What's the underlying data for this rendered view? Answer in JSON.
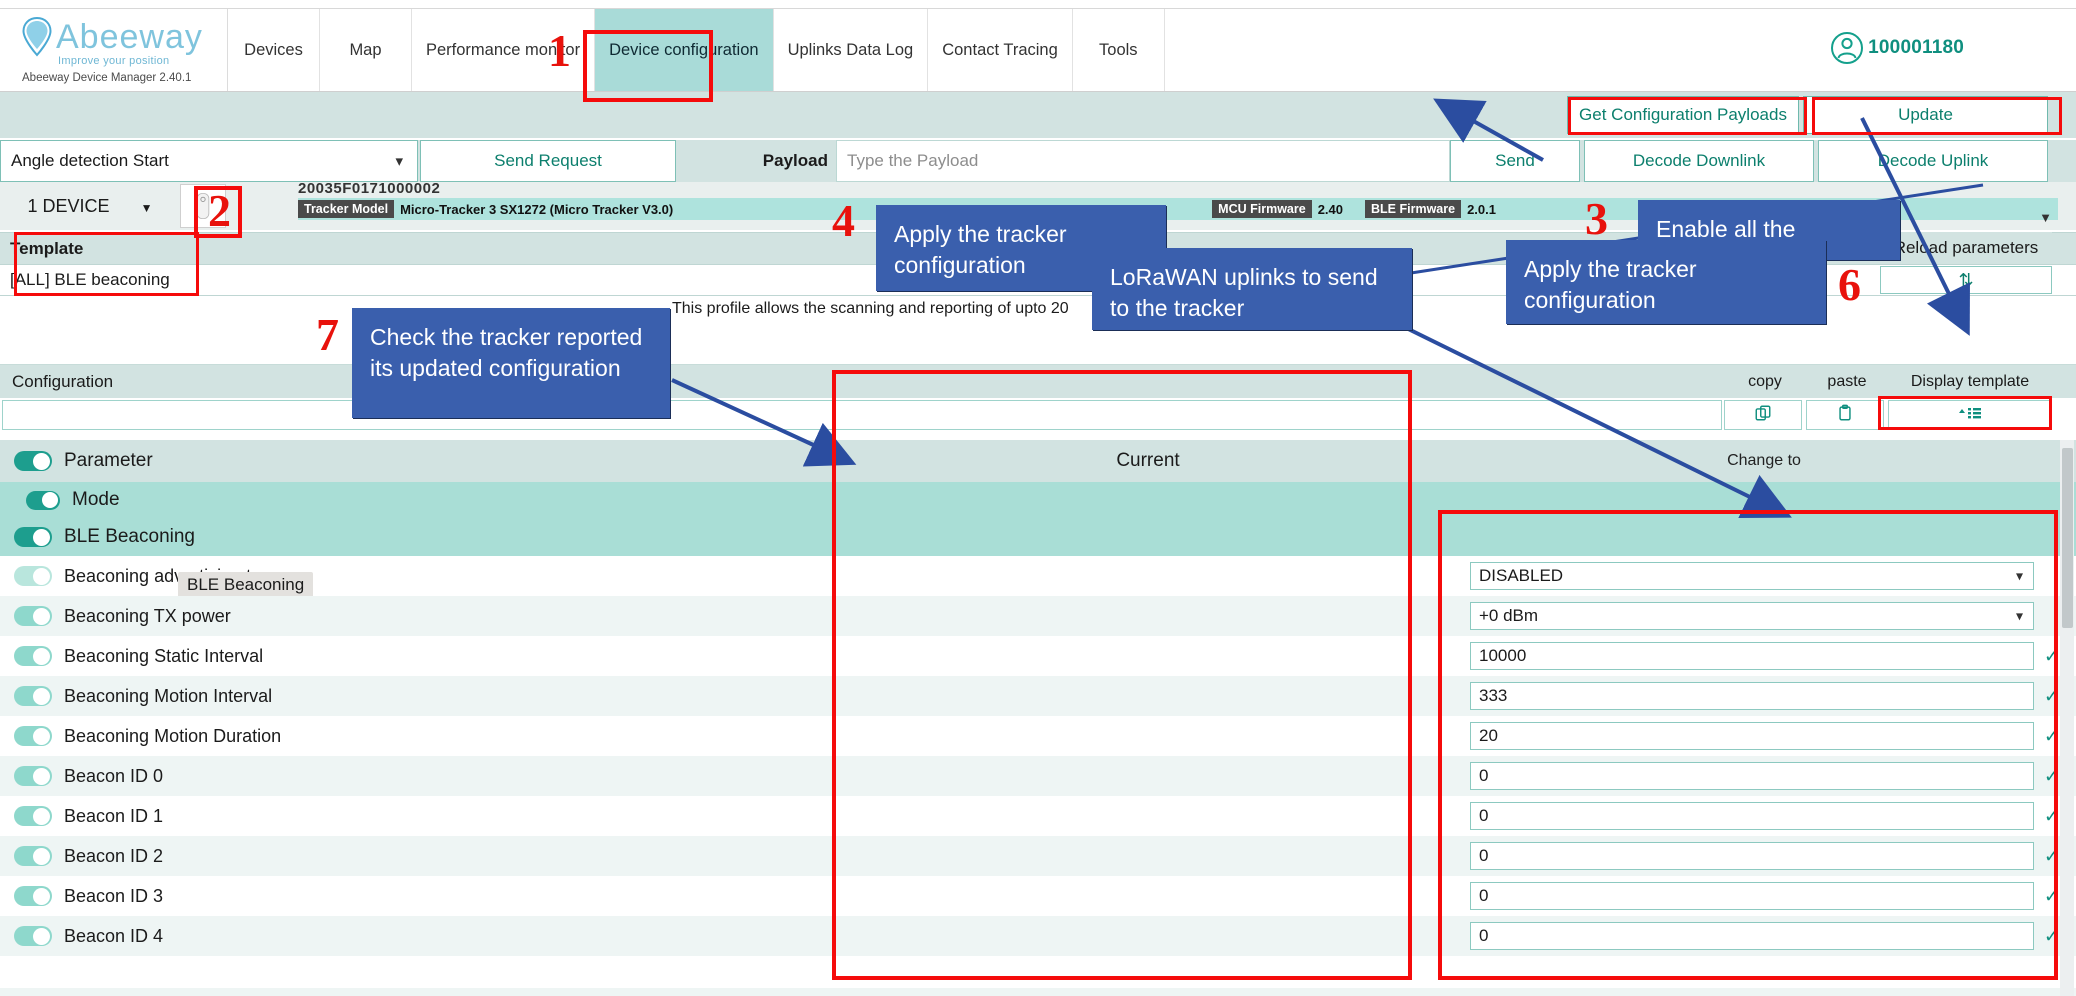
{
  "brand": {
    "name": "Abeeway",
    "tagline": "Improve your position",
    "version": "Abeeway Device Manager 2.40.1",
    "pin_icon": "location-pin-icon"
  },
  "nav": {
    "tabs": [
      {
        "label": "Devices",
        "active": false
      },
      {
        "label": "Map",
        "active": false
      },
      {
        "label": "Performance monitor",
        "active": false
      },
      {
        "label": "Device configuration",
        "active": true
      },
      {
        "label": "Uplinks Data Log",
        "active": false
      },
      {
        "label": "Contact Tracing",
        "active": false
      },
      {
        "label": "Tools",
        "active": false
      }
    ],
    "user": {
      "id": "100001180",
      "icon": "user-avatar-icon"
    }
  },
  "actions": {
    "get_config_payloads": "Get Configuration Payloads",
    "update": "Update"
  },
  "request": {
    "command_select_value": "Angle detection Start",
    "send_request": "Send Request",
    "payload_label": "Payload",
    "payload_placeholder": "Type the Payload",
    "send": "Send",
    "decode_downlink": "Decode Downlink",
    "decode_uplink": "Decode Uplink"
  },
  "device": {
    "count_label": "1 DEVICE",
    "eui": "20035F0171000002",
    "tracker_model_label": "Tracker Model",
    "tracker_model_value": "Micro-Tracker 3 SX1272 (Micro Tracker V3.0)",
    "mcu_firmware_label": "MCU Firmware",
    "mcu_firmware_value": "2.40",
    "ble_firmware_label": "BLE Firmware",
    "ble_firmware_value": "2.0.1"
  },
  "template": {
    "header": "Template",
    "value": "[ALL] BLE beaconing",
    "reload_header": "Reload parameters",
    "reload_icon": "refresh-icon",
    "profile_description": "This profile allows the scanning and reporting of upto 20"
  },
  "configuration": {
    "header": "Configuration",
    "input_value": "",
    "copy_header": "copy",
    "paste_header": "paste",
    "display_template_header": "Display template",
    "copy_icon": "copy-icon",
    "paste_icon": "clipboard-icon",
    "display_template_icon": "list-sort-icon"
  },
  "table": {
    "columns": {
      "parameter": "Parameter",
      "current": "Current",
      "change_to": "Change to"
    },
    "tooltip": "BLE Beaconing",
    "rows": [
      {
        "label": "Mode",
        "type": "group",
        "toggle": "on",
        "current": "",
        "change": "",
        "control": "none",
        "tick": false
      },
      {
        "label": "BLE Beaconing",
        "type": "group2",
        "toggle": "on",
        "current": "",
        "change": "",
        "control": "none",
        "tick": false
      },
      {
        "label": "Beaconing advertising t",
        "type": "plain",
        "toggle": "faint",
        "current": "",
        "change": "DISABLED",
        "control": "select",
        "tick": false
      },
      {
        "label": "Beaconing TX power",
        "type": "alt",
        "toggle": "light",
        "current": "",
        "change": "+0 dBm",
        "control": "select",
        "tick": false
      },
      {
        "label": "Beaconing Static Interval",
        "type": "plain",
        "toggle": "light",
        "current": "",
        "change": "10000",
        "control": "text",
        "tick": true
      },
      {
        "label": "Beaconing Motion Interval",
        "type": "alt",
        "toggle": "light",
        "current": "",
        "change": "333",
        "control": "text",
        "tick": true
      },
      {
        "label": "Beaconing Motion Duration",
        "type": "plain",
        "toggle": "light",
        "current": "",
        "change": "20",
        "control": "text",
        "tick": true
      },
      {
        "label": "Beacon ID 0",
        "type": "alt",
        "toggle": "light",
        "current": "",
        "change": "0",
        "control": "text",
        "tick": true
      },
      {
        "label": "Beacon ID 1",
        "type": "plain",
        "toggle": "light",
        "current": "",
        "change": "0",
        "control": "text",
        "tick": true
      },
      {
        "label": "Beacon ID 2",
        "type": "alt",
        "toggle": "light",
        "current": "",
        "change": "0",
        "control": "text",
        "tick": true
      },
      {
        "label": "Beacon ID 3",
        "type": "plain",
        "toggle": "light",
        "current": "",
        "change": "0",
        "control": "text",
        "tick": true
      },
      {
        "label": "Beacon ID 4",
        "type": "alt",
        "toggle": "light",
        "current": "",
        "change": "0",
        "control": "text",
        "tick": true
      }
    ]
  },
  "annotations": {
    "numbers": [
      "1",
      "2",
      "3",
      "4",
      "6",
      "7"
    ],
    "callouts": [
      {
        "id": "callout-apply-1",
        "text": "Apply the tracker configuration"
      },
      {
        "id": "callout-lorawan",
        "text": "LoRaWAN uplinks to send to the tracker"
      },
      {
        "id": "callout-enable-all",
        "text": "Enable all the"
      },
      {
        "id": "callout-apply-2",
        "text": "Apply the tracker configuration"
      },
      {
        "id": "callout-check-tracker",
        "text": "Check the tracker reported its updated configuration"
      }
    ]
  },
  "colors": {
    "accent_teal": "#0c7f6d",
    "nav_active": "#a9dbd8",
    "band": "#d2e3e1",
    "annotation_blue": "#3a5fad",
    "annotation_red": "#e8120c",
    "brand_blue": "#7fc4dd"
  }
}
